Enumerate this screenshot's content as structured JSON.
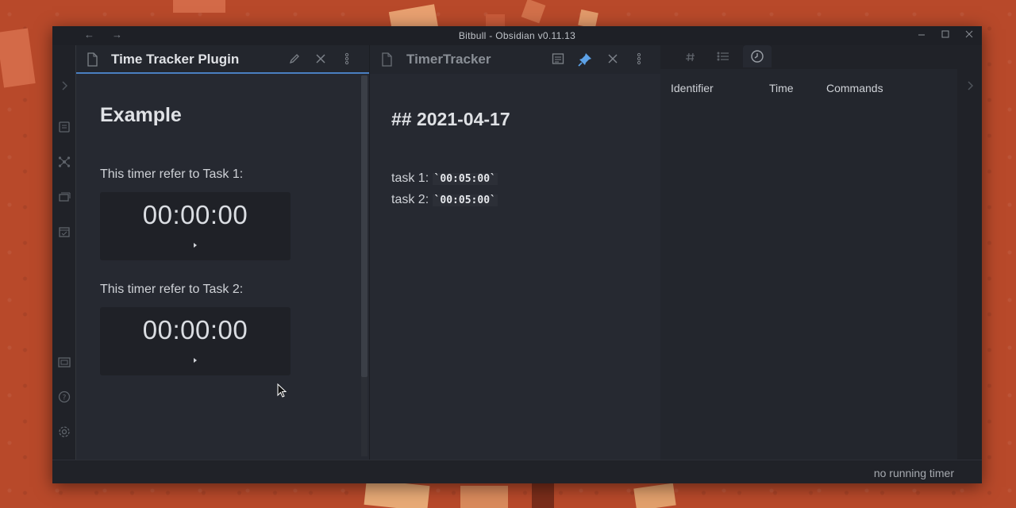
{
  "window": {
    "title": "Bitbull - Obsidian v0.11.13",
    "back": "←",
    "forward": "→"
  },
  "pane1": {
    "tab_title": "Time Tracker Plugin",
    "heading": "Example",
    "timer1_label": "This timer refer to Task 1:",
    "timer1_value": "00:00:00",
    "timer2_label": "This timer refer to Task 2:",
    "timer2_value": "00:00:00"
  },
  "pane2": {
    "tab_title": "TimerTracker",
    "heading": "## 2021-04-17",
    "tasks": [
      {
        "label": "task 1: ",
        "value": "`00:05:00`"
      },
      {
        "label": "task 2: ",
        "value": "`00:05:00`"
      }
    ]
  },
  "pane3": {
    "columns": [
      "Identifier",
      "Time",
      "Commands"
    ]
  },
  "status": {
    "text": "no running timer"
  },
  "colors": {
    "accent": "#4a7fc1",
    "pin": "#5da2e8"
  }
}
